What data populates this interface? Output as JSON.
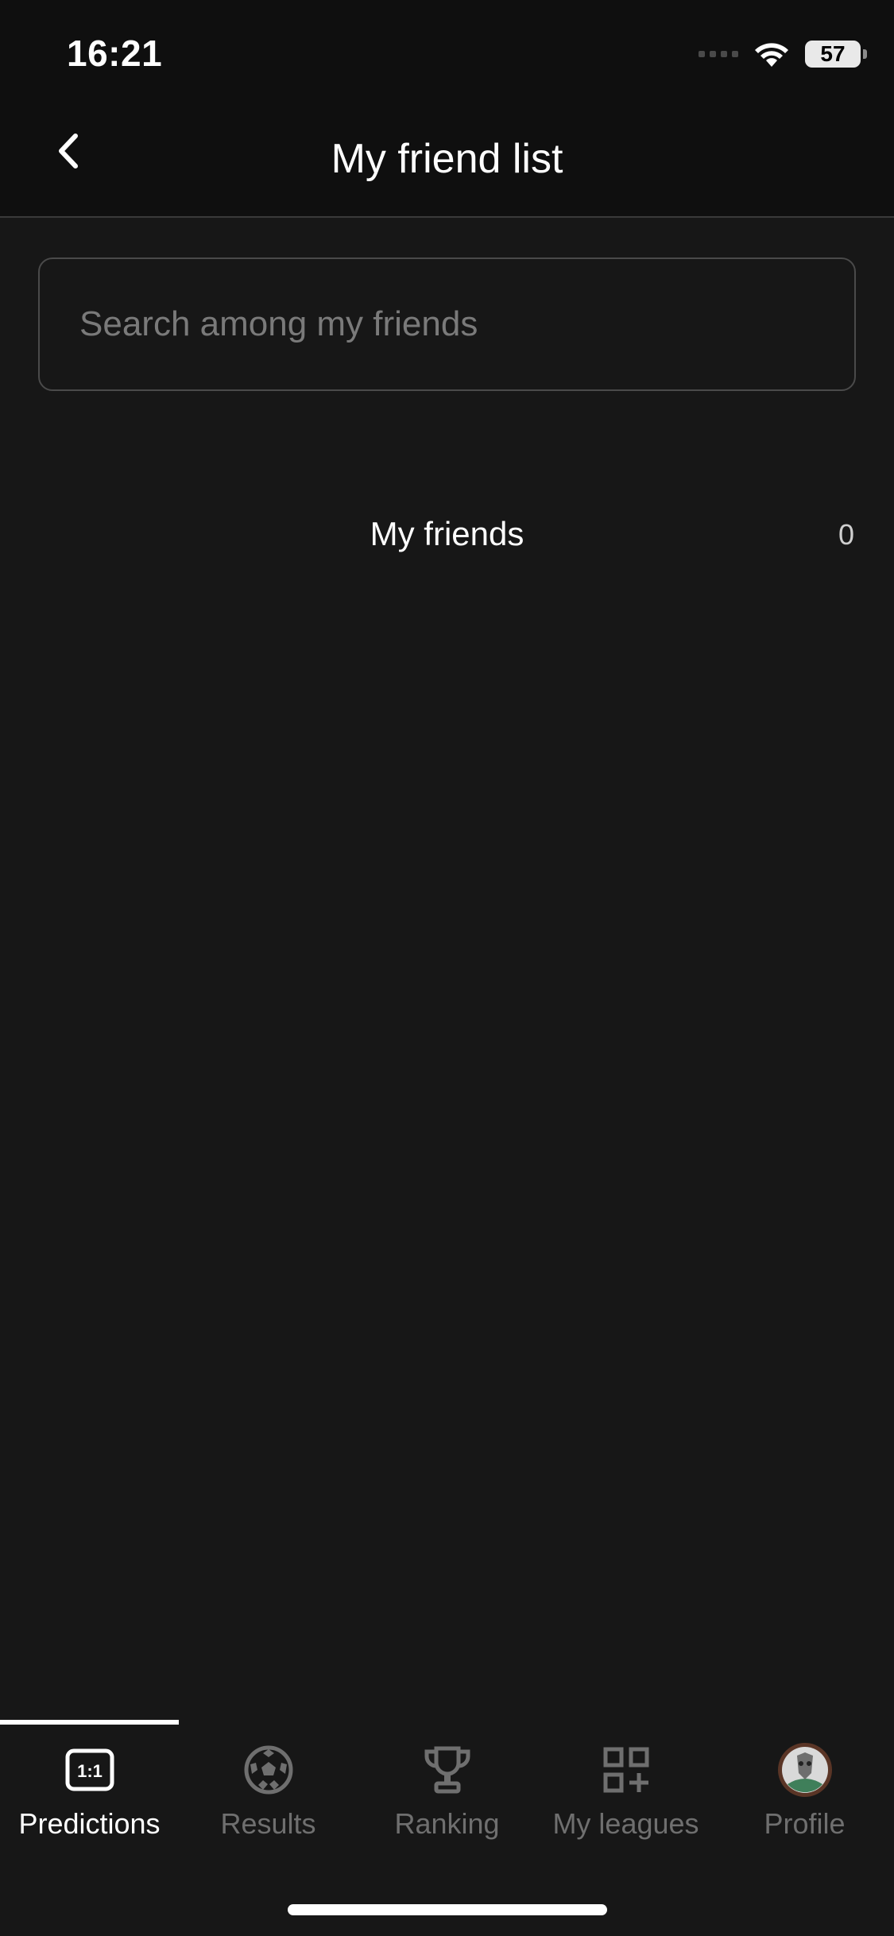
{
  "status": {
    "time": "16:21",
    "battery": "57"
  },
  "header": {
    "title": "My friend list"
  },
  "search": {
    "placeholder": "Search among my friends"
  },
  "friends": {
    "label": "My friends",
    "count": "0"
  },
  "tabs": [
    {
      "label": "Predictions",
      "icon": "score-1-1-icon",
      "active": true
    },
    {
      "label": "Results",
      "icon": "soccer-ball-icon",
      "active": false
    },
    {
      "label": "Ranking",
      "icon": "trophy-icon",
      "active": false
    },
    {
      "label": "My leagues",
      "icon": "grid-plus-icon",
      "active": false
    },
    {
      "label": "Profile",
      "icon": "avatar-icon",
      "active": false
    }
  ],
  "colors": {
    "background": "#171717",
    "header": "#0f0f0f",
    "active": "#ffffff",
    "inactive": "#6f6f6f"
  }
}
